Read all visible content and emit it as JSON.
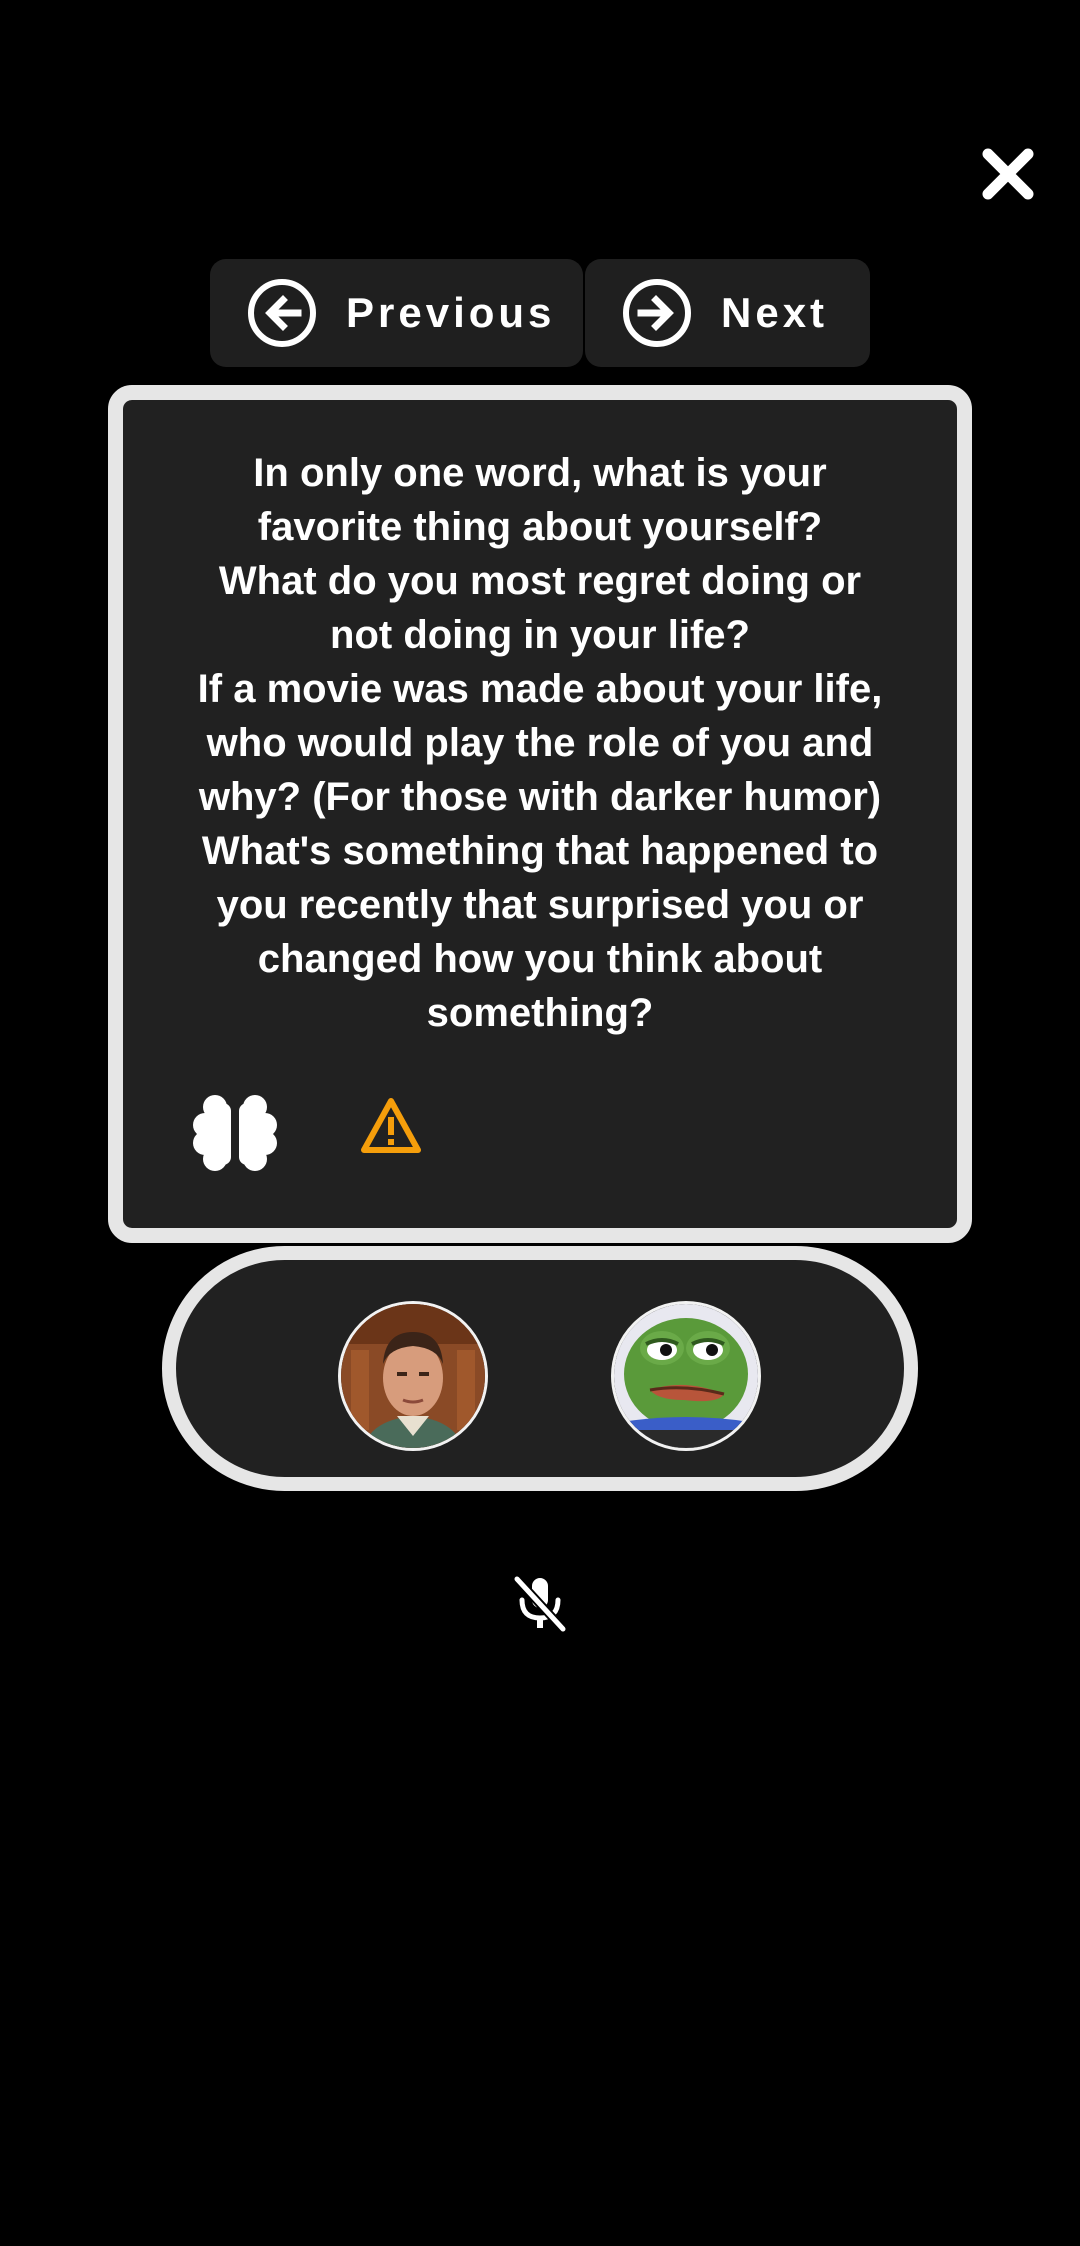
{
  "nav": {
    "previous_label": "Previous",
    "next_label": "Next"
  },
  "card": {
    "question": "In only one word, what is your\nfavorite thing about yourself?\nWhat do you most regret doing or\nnot doing in your life?\nIf a movie was made about your life,\nwho would play the role of you and\nwhy? (For those with darker humor)\nWhat's something that happened to\nyou recently that surprised you or\nchanged how you think about\nsomething?",
    "icons": [
      "brain-icon",
      "warning-icon"
    ]
  },
  "participants": [
    {
      "avatar": "person-photo"
    },
    {
      "avatar": "frog-cartoon"
    }
  ],
  "icons": {
    "close": "close-icon",
    "previous": "arrow-left-circle-icon",
    "next": "arrow-right-circle-icon",
    "mic": "mic-off-icon"
  },
  "colors": {
    "background": "#000000",
    "surface": "#212121",
    "border": "#e6e6e6",
    "warning": "#f59e0b",
    "text": "#ffffff"
  }
}
